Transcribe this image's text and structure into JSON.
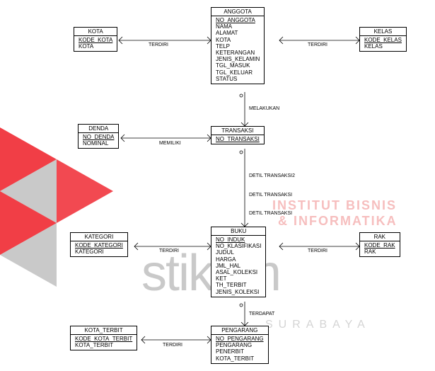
{
  "entities": {
    "kota": {
      "title": "KOTA",
      "attrs": [
        [
          "KODE_KOTA",
          true
        ],
        [
          "KOTA",
          false
        ]
      ]
    },
    "anggota": {
      "title": "ANGGOTA",
      "attrs": [
        [
          "NO_ANGGOTA",
          true
        ],
        [
          "NAMA",
          false
        ],
        [
          "ALAMAT",
          false
        ],
        [
          "KOTA",
          false
        ],
        [
          "TELP",
          false
        ],
        [
          "KETERANGAN",
          false
        ],
        [
          "JENIS_KELAMIN",
          false
        ],
        [
          "TGL_MASUK",
          false
        ],
        [
          "TGL_KELUAR",
          false
        ],
        [
          "STATUS",
          false
        ]
      ]
    },
    "kelas": {
      "title": "KELAS",
      "attrs": [
        [
          "KODE_KELAS",
          true
        ],
        [
          "KELAS",
          false
        ]
      ]
    },
    "denda": {
      "title": "DENDA",
      "attrs": [
        [
          "NO_DENDA",
          true
        ],
        [
          "NOMINAL",
          false
        ]
      ]
    },
    "transaksi": {
      "title": "TRANSAKSI",
      "attrs": [
        [
          "NO_TRANSAKSI",
          true
        ]
      ]
    },
    "kategori": {
      "title": "KATEGORI",
      "attrs": [
        [
          "KODE_KATEGORI",
          true
        ],
        [
          "KATEGORI",
          false
        ]
      ]
    },
    "buku": {
      "title": "BUKU",
      "attrs": [
        [
          "NO_INDUK",
          true
        ],
        [
          "NO_KLASIFIKASI",
          false
        ],
        [
          "JUDUL",
          false
        ],
        [
          "HARGA",
          false
        ],
        [
          "JML_HAL",
          false
        ],
        [
          "ASAL_KOLEKSI",
          false
        ],
        [
          "KET",
          false
        ],
        [
          "TH_TERBIT",
          false
        ],
        [
          "JENIS_KOLEKSI",
          false
        ]
      ]
    },
    "rak": {
      "title": "RAK",
      "attrs": [
        [
          "KODE_RAK",
          true
        ],
        [
          "RAK",
          false
        ]
      ]
    },
    "kota_terbit": {
      "title": "KOTA_TERBIT",
      "attrs": [
        [
          "KODE_KOTA_TERBIT",
          true
        ],
        [
          "KOTA_TERBIT",
          false
        ]
      ]
    },
    "pengarang": {
      "title": "PENGARANG",
      "attrs": [
        [
          "NO_PENGARANG",
          true
        ],
        [
          "PENGARANG",
          false
        ],
        [
          "PENERBIT",
          false
        ],
        [
          "KOTA_TERBIT",
          false
        ]
      ]
    }
  },
  "relations": {
    "terdiri1": "TERDIRI",
    "terdiri2": "TERDIRI",
    "melakukan": "MELAKUKAN",
    "memiliki": "MEMILIKI",
    "detil2": "DETIL TRANSAKSI2",
    "detil1a": "DETIL TRANSAKSI",
    "detil1b": "DETIL TRANSAKSI",
    "terdiri3": "TERDIRI",
    "terdiri4": "TERDIRI",
    "terdapat": "TERDAPAT",
    "terdiri5": "TERDIRI"
  },
  "watermark": {
    "line1": "INSTITUT BISNIS",
    "line2": "& INFORMATIKA",
    "brand": "stikom",
    "city": "SURABAYA"
  }
}
